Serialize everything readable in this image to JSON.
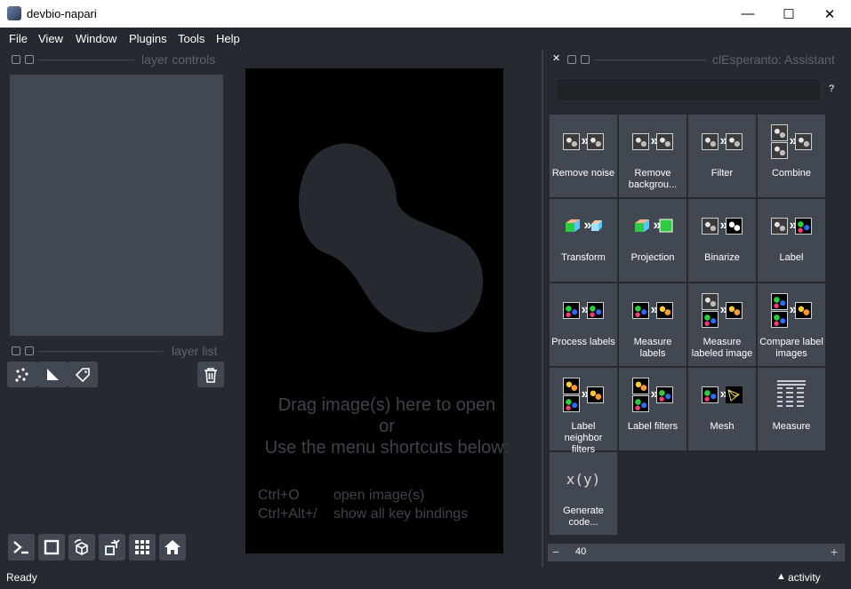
{
  "window": {
    "title": "devbio-napari",
    "minimize": "—",
    "maximize": "☐",
    "close": "✕"
  },
  "menu": [
    "File",
    "View",
    "Window",
    "Plugins",
    "Tools",
    "Help"
  ],
  "left_panel": {
    "layer_controls_title": "layer controls",
    "layer_list_title": "layer list"
  },
  "canvas": {
    "drag_line1": "Drag image(s) here to open",
    "drag_line2": "or",
    "drag_line3": "Use the menu shortcuts below:",
    "shortcuts": [
      {
        "key": "Ctrl+O",
        "desc": "open image(s)"
      },
      {
        "key": "Ctrl+Alt+/",
        "desc": "show all key bindings"
      }
    ]
  },
  "assistant": {
    "title": "clEsperanto: Assistant",
    "help": "?",
    "tiles": [
      {
        "label": "Remove noise",
        "icons": "gray-gray"
      },
      {
        "label": "Remove backgrou...",
        "icons": "gray-gray"
      },
      {
        "label": "Filter",
        "icons": "gray-gray"
      },
      {
        "label": "Combine",
        "icons": "gray2-gray"
      },
      {
        "label": "Transform",
        "icons": "cube-cube"
      },
      {
        "label": "Projection",
        "icons": "cube-square"
      },
      {
        "label": "Binarize",
        "icons": "gray-bw"
      },
      {
        "label": "Label",
        "icons": "gray-label"
      },
      {
        "label": "Process labels",
        "icons": "label-label"
      },
      {
        "label": "Measure labels",
        "icons": "label-meas"
      },
      {
        "label": "Measure labeled image",
        "icons": "graylabel-meas"
      },
      {
        "label": "Compare label images",
        "icons": "label2-meas"
      },
      {
        "label": "Label neighbor filters",
        "icons": "meas2-meas"
      },
      {
        "label": "Label filters",
        "icons": "meas2-label"
      },
      {
        "label": "Mesh",
        "icons": "label-mesh"
      },
      {
        "label": "Measure",
        "icons": "table"
      },
      {
        "label": "Generate code...",
        "icons": "code"
      }
    ],
    "code_glyph": "x(y)",
    "slider_value": "40",
    "slider_minus": "−",
    "slider_plus": "+"
  },
  "status": {
    "text": "Ready",
    "activity": "activity"
  }
}
